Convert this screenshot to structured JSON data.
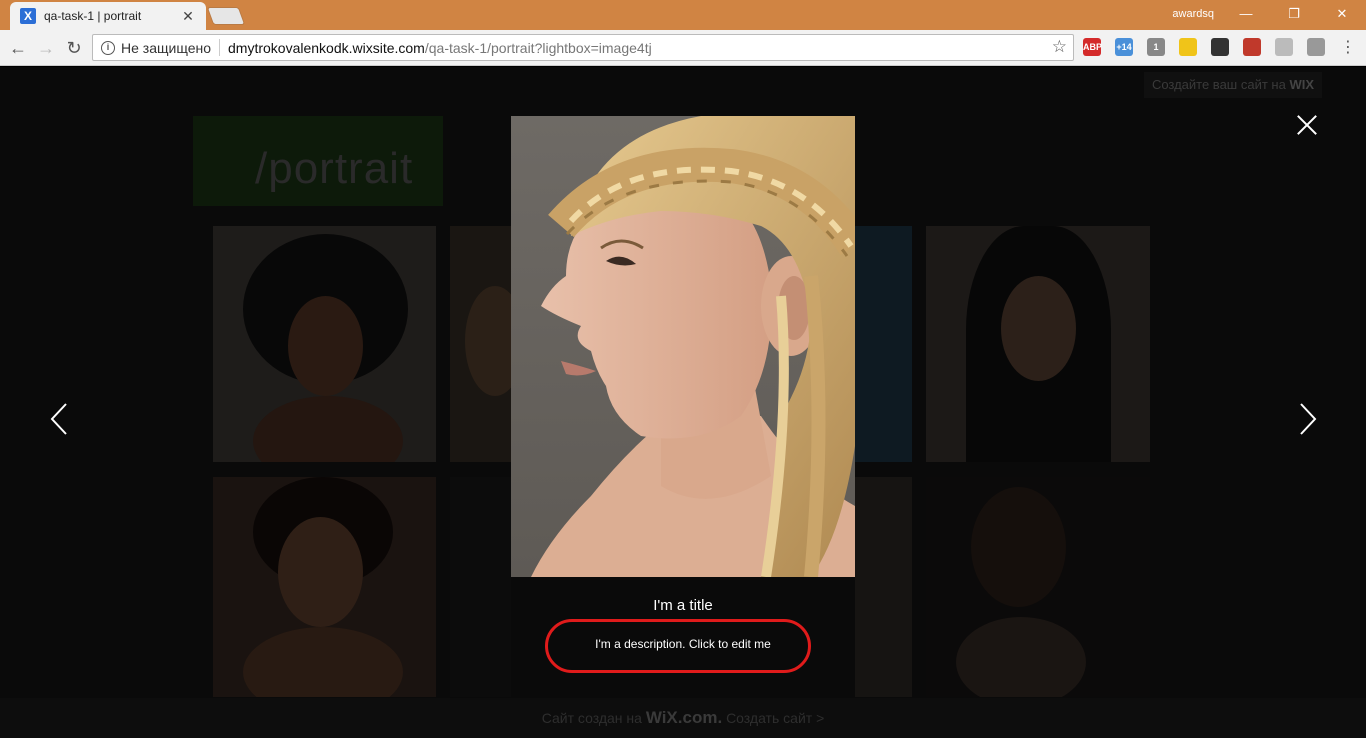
{
  "browser": {
    "tab_title": "qa-task-1 | portrait",
    "tab_favicon": "X",
    "tab_close": "✕",
    "profile_name": "awardsq",
    "window_buttons": [
      "—",
      "❐",
      "✕"
    ],
    "security_label": "Не защищено",
    "url_host": "dmytrokovalenkodk.wixsite.com",
    "url_path": "/qa-task-1/portrait?lightbox=image4tj",
    "extensions": [
      {
        "name": "adblock-plus-icon",
        "label": "ABP",
        "color": "#d42a2a"
      },
      {
        "name": "cloud-extension-icon",
        "label": "+14",
        "color": "#4a90d9"
      },
      {
        "name": "shield-extension-icon",
        "label": "1",
        "color": "#888888"
      },
      {
        "name": "bulb-extension-icon",
        "label": "",
        "color": "#f0c419"
      },
      {
        "name": "gear-extension-icon",
        "label": "",
        "color": "#333333"
      },
      {
        "name": "cross-extension-icon",
        "label": "",
        "color": "#c0392b"
      },
      {
        "name": "diamond-extension-icon",
        "label": "",
        "color": "#bbbbbb"
      },
      {
        "name": "hash-extension-icon",
        "label": "",
        "color": "#999999"
      }
    ]
  },
  "site": {
    "wix_banner_text": "Создайте ваш сайт на",
    "wix_banner_brand": "WIX",
    "page_title": "/portrait",
    "footer_text": "Сайт создан на",
    "footer_brand": "WiX.com.",
    "footer_link": "Создать сайт >"
  },
  "lightbox": {
    "title": "I'm a title",
    "description": "I'm a description. Click to edit me"
  },
  "colors": {
    "browser_frame": "#d08443",
    "annotation": "#e01b1b"
  }
}
